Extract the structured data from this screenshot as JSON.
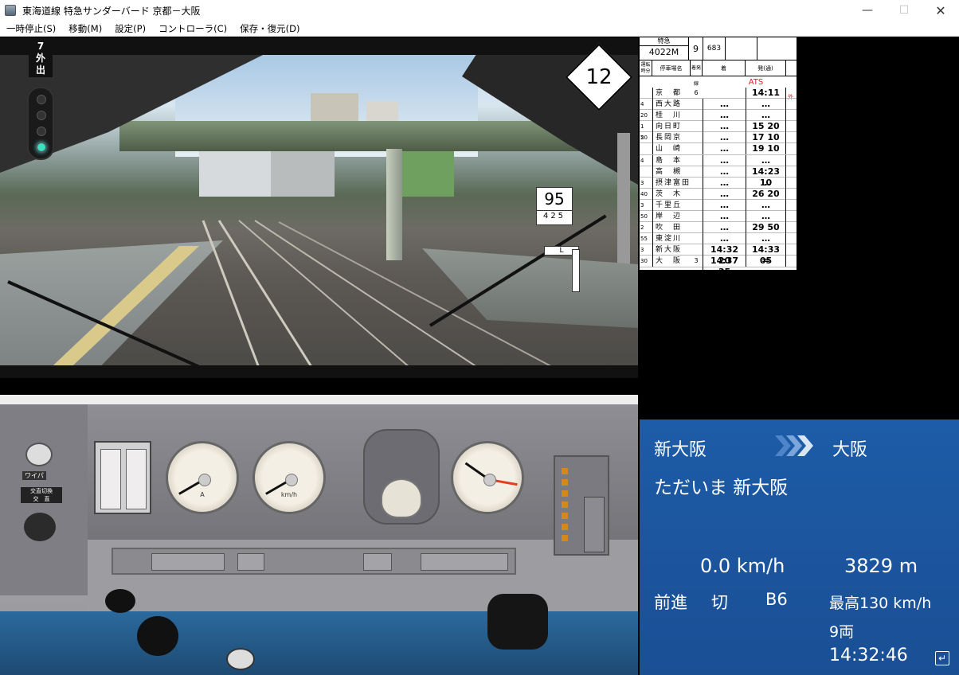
{
  "window": {
    "title": "東海道線 特急サンダーバード 京都－大阪",
    "minimize_glyph": "—",
    "maximize_glyph": "☐",
    "close_glyph": "✕",
    "app_icon": "train-icon"
  },
  "menu": [
    {
      "label": "一時停止(S)"
    },
    {
      "label": "移動(M)"
    },
    {
      "label": "設定(P)"
    },
    {
      "label": "コントローラ(C)"
    },
    {
      "label": "保存・復元(D)"
    }
  ],
  "cab": {
    "section_sign": [
      "7",
      "外",
      "出"
    ],
    "signal_aspect": "green",
    "speed_limit": "12",
    "km_post_main": "95",
    "km_post_sub": "425",
    "l_sign": "L"
  },
  "timetable": {
    "train_type": "特急",
    "train_number": "4022M",
    "cars": "9",
    "series": "683",
    "col_run": "運転時分",
    "col_station": "停車場名",
    "col_track": "着発線",
    "col_arrive": "着",
    "col_depart": "発(通)",
    "ats": "ATS",
    "side_note": "外",
    "rows": [
      {
        "run": "",
        "station": "京　都",
        "track": "6",
        "arrive": "",
        "depart": "14:11"
      },
      {
        "run": "4 20",
        "station": "西大路",
        "track": "",
        "arrive": "…",
        "depart": "…"
      },
      {
        "run": "",
        "station": "桂　川",
        "track": "",
        "arrive": "…",
        "depart": "…"
      },
      {
        "run": "1 50",
        "station": "向日町",
        "track": "",
        "arrive": "…",
        "depart": "15 20"
      },
      {
        "run": "2",
        "station": "長岡京",
        "track": "",
        "arrive": "…",
        "depart": "17 10"
      },
      {
        "run": "",
        "station": "山　崎",
        "track": "",
        "arrive": "…",
        "depart": "19 10"
      },
      {
        "run": "4",
        "station": "島　本",
        "track": "",
        "arrive": "…",
        "depart": "…"
      },
      {
        "run": "",
        "station": "高　槻",
        "track": "",
        "arrive": "…",
        "depart": "14:23 10"
      },
      {
        "run": "3 40",
        "station": "摂津富田",
        "track": "",
        "arrive": "…",
        "depart": "…"
      },
      {
        "run": "",
        "station": "茨　木",
        "track": "",
        "arrive": "…",
        "depart": "26 20"
      },
      {
        "run": "3 50",
        "station": "千里丘",
        "track": "",
        "arrive": "…",
        "depart": "…"
      },
      {
        "run": "",
        "station": "岸　辺",
        "track": "",
        "arrive": "…",
        "depart": "…"
      },
      {
        "run": "2 55",
        "station": "吹　田",
        "track": "",
        "arrive": "…",
        "depart": "29 50"
      },
      {
        "run": "",
        "station": "東淀川",
        "track": "",
        "arrive": "…",
        "depart": "…"
      },
      {
        "run": "3 30",
        "station": "新大阪",
        "track": "",
        "arrive": "14:32 20",
        "depart": "14:33 05"
      },
      {
        "run": "",
        "station": "大　阪",
        "track": "3",
        "arrive": "14:37 35",
        "depart": "＝"
      }
    ]
  },
  "dashboard": {
    "wiper_label": "ワイパ",
    "switch_label": "交直切換\n交　直",
    "gauge_amp_label": "A",
    "gauge_speed_label": "km/h",
    "gauge_pressure_label": ""
  },
  "info": {
    "current_station": "新大阪",
    "next_station": "大阪",
    "message": "ただいま 新大阪",
    "speed": "0.0 km/h",
    "distance": "3829 m",
    "direction": "前進",
    "power": "切",
    "brake": "B6",
    "max_speed": "最高130 km/h",
    "cars": "9両",
    "clock": "14:32:46",
    "enter_glyph": "↵"
  }
}
